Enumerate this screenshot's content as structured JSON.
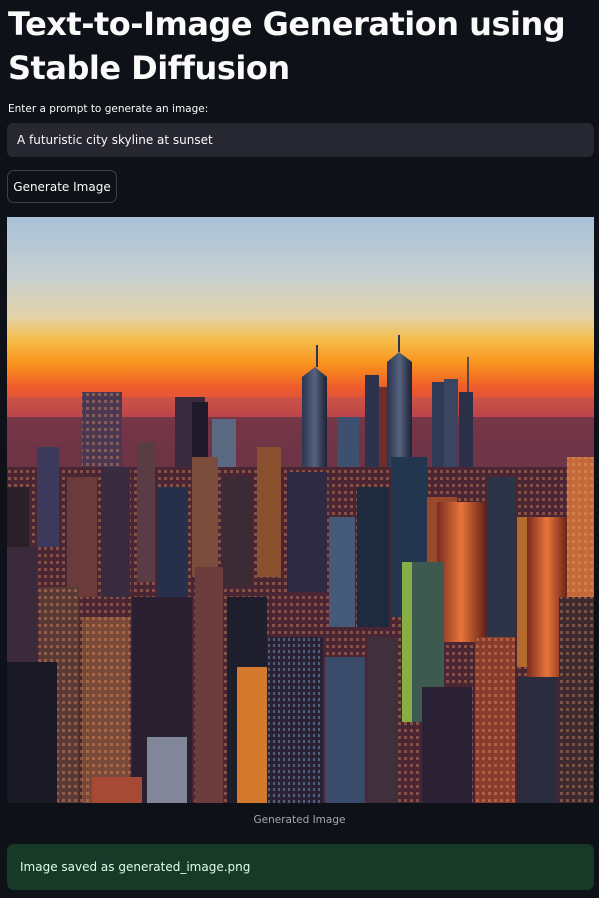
{
  "page": {
    "title": "Text-to-Image Generation using Stable Diffusion"
  },
  "prompt": {
    "label": "Enter a prompt to generate an image:",
    "value": "A futuristic city skyline at sunset"
  },
  "actions": {
    "generate_label": "Generate Image"
  },
  "result": {
    "caption": "Generated Image",
    "status_message": "Image saved as generated_image.png"
  },
  "colors": {
    "background": "#0e1117",
    "input_background": "#262730",
    "success_background": "#173928",
    "success_text": "#dffde9"
  }
}
